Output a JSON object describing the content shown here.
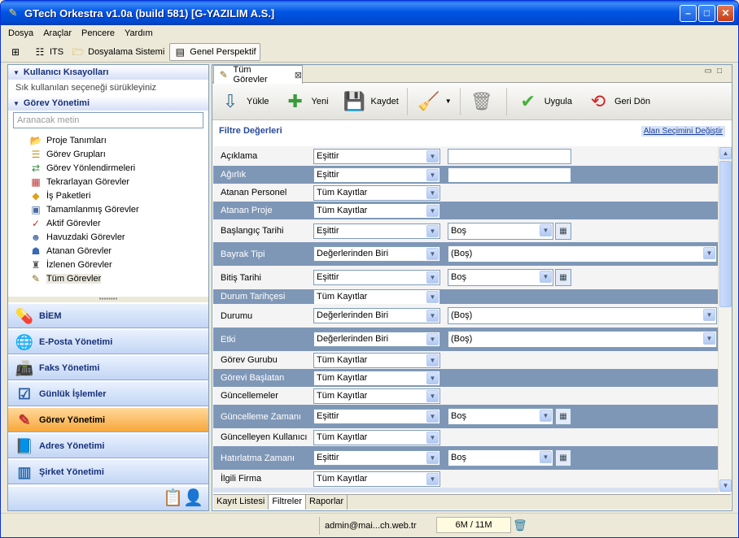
{
  "window": {
    "title": "GTech Orkestra v1.0a (build 581) [G-YAZILIM A.S.]",
    "min": "–",
    "max": "□",
    "close": "✕"
  },
  "menu": [
    "Dosya",
    "Araçlar",
    "Pencere",
    "Yardım"
  ],
  "toolbar": {
    "its": "ITS",
    "dosyalama": "Dosyalama Sistemi",
    "perspektif": "Genel Perspektif"
  },
  "left": {
    "shortcuts_title": "Kullanıcı Kısayolları",
    "shortcuts_hint": "Sık kullanılan seçeneği sürükleyiniz",
    "gorev_title": "Görev Yönetimi",
    "search_placeholder": "Aranacak metin",
    "tree": [
      {
        "label": "Proje Tanımları",
        "icon": "folder-icon"
      },
      {
        "label": "Görev Grupları",
        "icon": "stack-icon"
      },
      {
        "label": "Görev Yönlendirmeleri",
        "icon": "route-icon"
      },
      {
        "label": "Tekrarlayan Görevler",
        "icon": "calendar-icon"
      },
      {
        "label": "İş Paketleri",
        "icon": "package-icon"
      },
      {
        "label": "Tamamlanmış Görevler",
        "icon": "done-icon"
      },
      {
        "label": "Aktif Görevler",
        "icon": "active-icon"
      },
      {
        "label": "Havuzdaki Görevler",
        "icon": "pool-icon"
      },
      {
        "label": "Atanan Görevler",
        "icon": "assigned-icon"
      },
      {
        "label": "İzlenen Görevler",
        "icon": "watched-icon"
      },
      {
        "label": "Tüm Görevler",
        "icon": "all-tasks-icon"
      }
    ],
    "nav": [
      {
        "label": "BİEM",
        "icon": "pill-icon"
      },
      {
        "label": "E-Posta Yönetimi",
        "icon": "globe-icon"
      },
      {
        "label": "Faks Yönetimi",
        "icon": "fax-icon"
      },
      {
        "label": "Günlük İşlemler",
        "icon": "checklist-icon"
      },
      {
        "label": "Görev Yönetimi",
        "icon": "task-icon"
      },
      {
        "label": "Adres Yönetimi",
        "icon": "addressbook-icon"
      },
      {
        "label": "Şirket Yönetimi",
        "icon": "company-icon"
      }
    ]
  },
  "main": {
    "tab": "Tüm Görevler",
    "actions": {
      "yukle": "Yükle",
      "yeni": "Yeni",
      "kaydet": "Kaydet",
      "uygula": "Uygula",
      "geri_don": "Geri Dön"
    },
    "filter_title": "Filtre Değerleri",
    "alan_link": "Alan Seçimini Değiştir",
    "rows": [
      {
        "label": "Açıklama",
        "op": "Eşittir",
        "kind": "text",
        "value": ""
      },
      {
        "label": "Ağırlık",
        "op": "Eşittir",
        "kind": "text",
        "value": ""
      },
      {
        "label": "Atanan Personel",
        "op": "Tüm Kayıtlar",
        "kind": "none"
      },
      {
        "label": "Atanan Proje",
        "op": "Tüm Kayıtlar",
        "kind": "none"
      },
      {
        "label": "Başlangıç Tarihi",
        "op": "Eşittir",
        "kind": "date",
        "value": "Boş"
      },
      {
        "label": "Bayrak Tipi",
        "op": "Değerlerinden Biri",
        "kind": "wide",
        "value": "(Boş)"
      },
      {
        "label": "Bitiş Tarihi",
        "op": "Eşittir",
        "kind": "date",
        "value": "Boş"
      },
      {
        "label": "Durum Tarihçesi",
        "op": "Tüm Kayıtlar",
        "kind": "none"
      },
      {
        "label": "Durumu",
        "op": "Değerlerinden Biri",
        "kind": "wide",
        "value": "(Boş)"
      },
      {
        "label": "Etki",
        "op": "Değerlerinden Biri",
        "kind": "wide",
        "value": "(Boş)"
      },
      {
        "label": "Görev Gurubu",
        "op": "Tüm Kayıtlar",
        "kind": "none"
      },
      {
        "label": "Görevi Başlatan",
        "op": "Tüm Kayıtlar",
        "kind": "none"
      },
      {
        "label": "Güncellemeler",
        "op": "Tüm Kayıtlar",
        "kind": "none"
      },
      {
        "label": "Güncelleme Zamanı",
        "op": "Eşittir",
        "kind": "date",
        "value": "Boş"
      },
      {
        "label": "Güncelleyen Kullanıcı",
        "op": "Tüm Kayıtlar",
        "kind": "none"
      },
      {
        "label": "Hatırlatma Zamanı",
        "op": "Eşittir",
        "kind": "date",
        "value": "Boş"
      },
      {
        "label": "İlgili Firma",
        "op": "Tüm Kayıtlar",
        "kind": "none"
      }
    ],
    "bottom_tabs": [
      "Kayıt Listesi",
      "Filtreler",
      "Raporlar"
    ]
  },
  "status": {
    "user": "admin@mai...ch.web.tr",
    "memory": "6M / 11M"
  }
}
